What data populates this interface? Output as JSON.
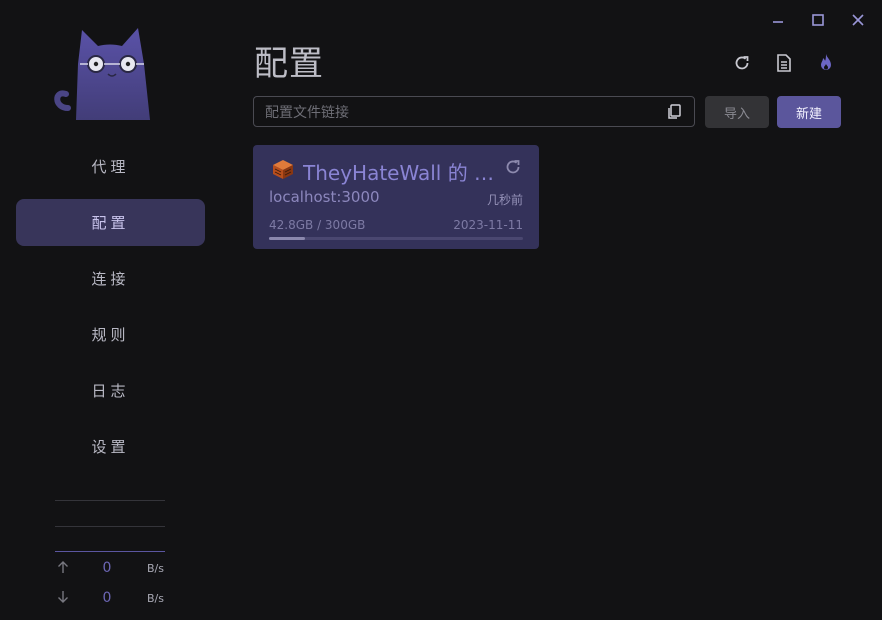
{
  "window": {
    "controls": [
      "minimize-icon",
      "maximize-icon",
      "close-icon"
    ]
  },
  "sidebar": {
    "items": [
      {
        "label": "代理",
        "active": false
      },
      {
        "label": "配置",
        "active": true
      },
      {
        "label": "连接",
        "active": false
      },
      {
        "label": "规则",
        "active": false
      },
      {
        "label": "日志",
        "active": false
      },
      {
        "label": "设置",
        "active": false
      }
    ],
    "traffic": {
      "upload": {
        "value": "0",
        "unit": "B/s"
      },
      "download": {
        "value": "0",
        "unit": "B/s"
      }
    }
  },
  "main": {
    "title": "配置",
    "header_icons": [
      "refresh-icon",
      "document-icon",
      "flame-icon"
    ],
    "url_input": {
      "value": "",
      "placeholder": "配置文件链接"
    },
    "import_label": "导入",
    "new_label": "新建",
    "profiles": [
      {
        "name": "TheyHateWall 的 …",
        "host": "localhost:3000",
        "updated": "几秒前",
        "usage": "42.8GB / 300GB",
        "expire": "2023-11-11",
        "usage_fraction": 0.143
      }
    ]
  },
  "colors": {
    "accent": "#5b569c",
    "active_nav": "#38355a",
    "card": "#34325a",
    "background": "#121214"
  }
}
